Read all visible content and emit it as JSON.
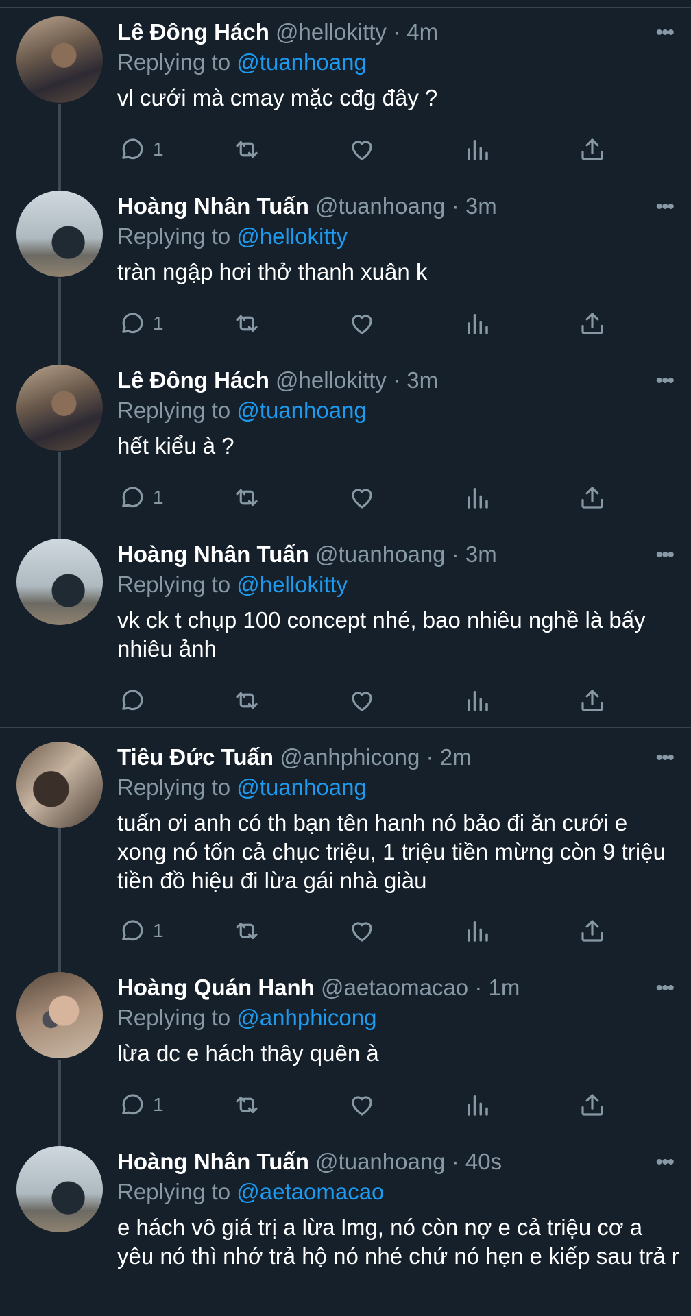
{
  "tweets": [
    {
      "name": "Lê Đông Hách",
      "handle": "@hellokitty",
      "time": "4m",
      "replying_label": "Replying to",
      "replying_to": "@tuanhoang",
      "text": "vl cưới mà cmay mặc cđg đây ?",
      "reply_count": "1"
    },
    {
      "name": "Hoàng Nhân Tuấn",
      "handle": "@tuanhoang",
      "time": "3m",
      "replying_label": "Replying to",
      "replying_to": "@hellokitty",
      "text": "tràn ngập hơi thở thanh xuân k",
      "reply_count": "1"
    },
    {
      "name": "Lê Đông Hách",
      "handle": "@hellokitty",
      "time": "3m",
      "replying_label": "Replying to",
      "replying_to": "@tuanhoang",
      "text": "hết kiểu à ?",
      "reply_count": "1"
    },
    {
      "name": "Hoàng Nhân Tuấn",
      "handle": "@tuanhoang",
      "time": "3m",
      "replying_label": "Replying to",
      "replying_to": "@hellokitty",
      "text": "vk ck t chụp 100 concept nhé, bao nhiêu nghề là bấy nhiêu ảnh",
      "reply_count": ""
    },
    {
      "name": "Tiêu Đức Tuấn",
      "handle": "@anhphicong",
      "time": "2m",
      "replying_label": "Replying to",
      "replying_to": "@tuanhoang",
      "text": "tuấn ơi anh có th bạn tên hanh nó bảo đi ăn cưới e xong nó tốn cả chục triệu, 1 triệu tiền mừng còn 9 triệu tiền đồ hiệu đi lừa gái nhà giàu",
      "reply_count": "1"
    },
    {
      "name": "Hoàng Quán Hanh",
      "handle": "@aetaomacao",
      "time": "1m",
      "replying_label": "Replying to",
      "replying_to": "@anhphicong",
      "text": "lừa dc e hách thây quên à",
      "reply_count": "1"
    },
    {
      "name": "Hoàng Nhân Tuấn",
      "handle": "@tuanhoang",
      "time": "40s",
      "replying_label": "Replying to",
      "replying_to": "@aetaomacao",
      "text": "e hách vô giá trị a lừa lmg, nó còn nợ e cả triệu cơ a yêu nó thì nhớ trả hộ nó nhé chứ nó hẹn e kiếp sau trả r",
      "reply_count": ""
    }
  ],
  "dot": "·",
  "more": "•••",
  "icons": {
    "reply": "reply-icon",
    "retweet": "retweet-icon",
    "like": "heart-icon",
    "stats": "analytics-icon",
    "share": "share-icon",
    "more": "more-icon"
  },
  "colors": {
    "background": "#15202b",
    "secondary_text": "#8899a6",
    "link": "#1d9bf0",
    "divider": "#38444d",
    "thread_line": "#3d4a55"
  }
}
